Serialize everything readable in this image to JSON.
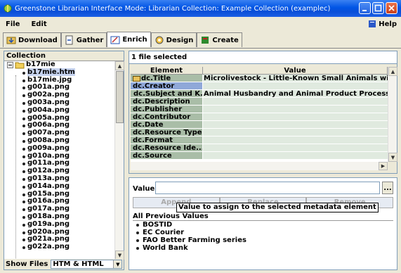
{
  "window": {
    "title": "Greenstone Librarian Interface  Mode: Librarian  Collection: Example Collection (examplec)"
  },
  "menu": {
    "file": "File",
    "edit": "Edit",
    "help": "Help"
  },
  "tabs": [
    {
      "label": "Download",
      "icon": "download-icon"
    },
    {
      "label": "Gather",
      "icon": "gather-icon"
    },
    {
      "label": "Enrich",
      "icon": "enrich-icon",
      "active": true
    },
    {
      "label": "Design",
      "icon": "design-icon"
    },
    {
      "label": "Create",
      "icon": "create-icon"
    }
  ],
  "collection": {
    "header": "Collection",
    "root": "b17mie",
    "files": [
      "b17mie.htm",
      "b17mie.jpg",
      "g001a.png",
      "g002a.png",
      "g003a.png",
      "g004a.png",
      "g005a.png",
      "g006a.png",
      "g007a.png",
      "g008a.png",
      "g009a.png",
      "g010a.png",
      "g011a.png",
      "g012a.png",
      "g013a.png",
      "g014a.png",
      "g015a.png",
      "g016a.png",
      "g017a.png",
      "g018a.png",
      "g019a.png",
      "g020a.png",
      "g021a.png",
      "g022a.png"
    ],
    "selected_file": "b17mie.htm",
    "show_files_label": "Show Files",
    "show_files_value": "HTM & HTML"
  },
  "metadata": {
    "selection_text": "1 file selected",
    "col_element": "Element",
    "col_value": "Value",
    "rows": [
      {
        "element": "dc.Title",
        "value": "Microlivestock - Little-Known Small Animals with a Prom",
        "icon": true
      },
      {
        "element": "dc.Creator",
        "value": "",
        "selected": true
      },
      {
        "element": "dc.Subject and K...",
        "value": "Animal Husbandry and Animal Product Processing|Other",
        "icon": true
      },
      {
        "element": "dc.Description",
        "value": ""
      },
      {
        "element": "dc.Publisher",
        "value": ""
      },
      {
        "element": "dc.Contributor",
        "value": ""
      },
      {
        "element": "dc.Date",
        "value": ""
      },
      {
        "element": "dc.Resource Type",
        "value": ""
      },
      {
        "element": "dc.Format",
        "value": ""
      },
      {
        "element": "dc.Resource Ide...",
        "value": ""
      },
      {
        "element": "dc.Source",
        "value": ""
      }
    ]
  },
  "editor": {
    "value_label": "Value",
    "value_input": "",
    "browse_label": "...",
    "append": "Append",
    "replace": "Replace",
    "remove": "Remove",
    "tooltip": "Value to assign to the selected metadata element",
    "previous_header": "All Previous Values",
    "previous_values": [
      "BOSTID",
      "EC Courier",
      "FAO Better Farming series",
      "World Bank"
    ]
  }
}
